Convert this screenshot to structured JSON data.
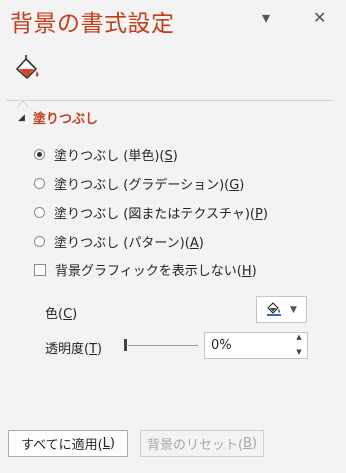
{
  "header": {
    "title": "背景の書式設定",
    "icons": [
      "chevron-down-icon",
      "close-icon"
    ],
    "close_glyph": "✕",
    "dropdown_glyph": "▾"
  },
  "tab": {
    "icon": "paint-bucket-icon"
  },
  "fill_section": {
    "title": "塗りつぶし",
    "options": [
      {
        "label": "塗りつぶし (単色)(",
        "key": "S",
        "suffix": ")",
        "checked": true
      },
      {
        "label": "塗りつぶし (グラデーション)(",
        "key": "G",
        "suffix": ")",
        "checked": false
      },
      {
        "label": "塗りつぶし (図またはテクスチャ)(",
        "key": "P",
        "suffix": ")",
        "checked": false
      },
      {
        "label": "塗りつぶし (パターン)(",
        "key": "A",
        "suffix": ")",
        "checked": false
      }
    ],
    "hide_graphics": {
      "label": "背景グラフィックを表示しない(",
      "key": "H",
      "suffix": ")",
      "checked": false
    }
  },
  "color": {
    "label": "色(",
    "key": "C",
    "suffix": ")"
  },
  "transparency": {
    "label": "透明度(",
    "key": "T",
    "suffix": ")",
    "value": "0%",
    "level": 0
  },
  "buttons": {
    "apply_all": {
      "label": "すべてに適用(",
      "key": "L",
      "suffix": ")"
    },
    "reset": {
      "label": "背景のリセット(",
      "key": "B",
      "suffix": ")"
    }
  },
  "colors": {
    "accent": "#c43e1c",
    "panel_bg": "#f3f3f3"
  }
}
